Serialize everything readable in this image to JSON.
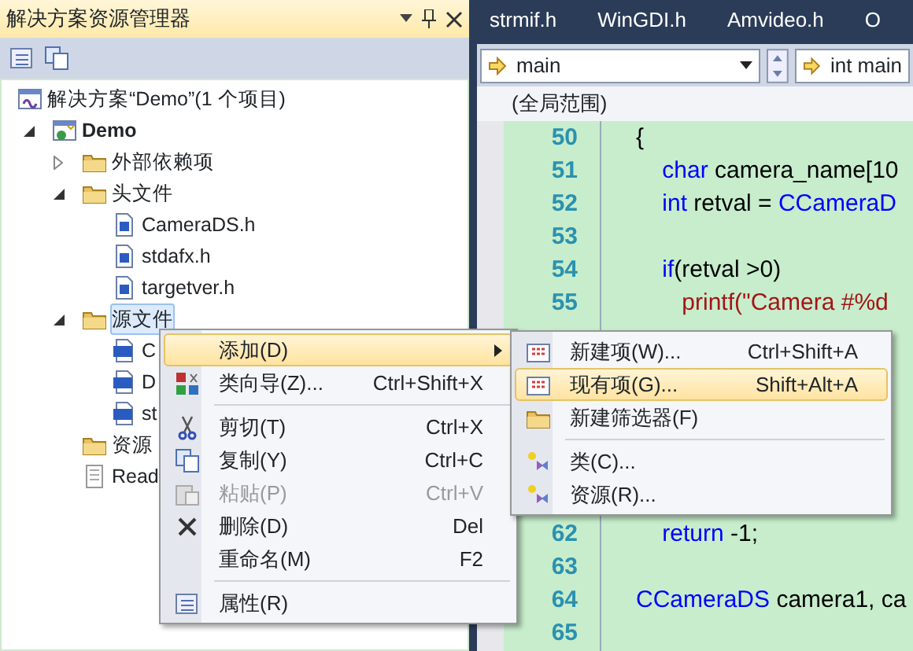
{
  "explorer": {
    "title": "解决方案资源管理器",
    "tree": [
      {
        "label": "解决方案“Demo”(1 个项目)",
        "kind": "solution",
        "selected": false,
        "children": [
          {
            "label": "Demo",
            "kind": "project",
            "expanded": true,
            "selected": false,
            "children": [
              {
                "label": "外部依赖项",
                "kind": "folder",
                "expanded": false,
                "selected": false
              },
              {
                "label": "头文件",
                "kind": "folder",
                "expanded": true,
                "selected": false,
                "children": [
                  {
                    "label": "CameraDS.h",
                    "kind": "header",
                    "selected": false
                  },
                  {
                    "label": "stdafx.h",
                    "kind": "header",
                    "selected": false
                  },
                  {
                    "label": "targetver.h",
                    "kind": "header",
                    "selected": false
                  }
                ]
              },
              {
                "label": "源文件",
                "kind": "folder",
                "expanded": true,
                "selected": true,
                "children": [
                  {
                    "label": "C",
                    "kind": "cpp",
                    "selected": false
                  },
                  {
                    "label": "D",
                    "kind": "cpp",
                    "selected": false
                  },
                  {
                    "label": "st",
                    "kind": "cpp",
                    "selected": false
                  }
                ]
              },
              {
                "label": "资源",
                "kind": "folder",
                "selected": false
              },
              {
                "label": "Read",
                "kind": "text",
                "selected": false
              }
            ]
          }
        ]
      }
    ]
  },
  "editor": {
    "tabs": [
      "strmif.h",
      "WinGDI.h",
      "Amvideo.h",
      "O"
    ],
    "nav": {
      "left": "main",
      "right": "int main"
    },
    "scope": "(全局范围)",
    "lines": [
      {
        "number": "50",
        "parts": [
          {
            "kind": "plain",
            "text": "{"
          }
        ]
      },
      {
        "number": "51",
        "parts": [
          {
            "kind": "keyword",
            "text": "    char"
          },
          {
            "kind": "plain",
            "text": " camera_name[10"
          }
        ]
      },
      {
        "number": "52",
        "parts": [
          {
            "kind": "keyword",
            "text": "    int"
          },
          {
            "kind": "plain",
            "text": " retval = "
          },
          {
            "kind": "type",
            "text": "CCameraD"
          }
        ]
      },
      {
        "number": "53"
      },
      {
        "number": "54",
        "parts": [
          {
            "kind": "keyword",
            "text": "    if"
          },
          {
            "kind": "plain",
            "text": "(retval >0)"
          }
        ]
      },
      {
        "number": "55",
        "parts": [
          {
            "kind": "string",
            "text": "       printf(\"Camera #%d"
          }
        ]
      },
      {
        "number": "62",
        "parts": [
          {
            "kind": "keyword",
            "text": "    return"
          },
          {
            "kind": "plain",
            "text": " -1;"
          }
        ]
      },
      {
        "number": "63"
      },
      {
        "number": "64",
        "parts": [
          {
            "kind": "type",
            "text": "CCameraDS"
          },
          {
            "kind": "plain",
            "text": " camera1, ca"
          }
        ]
      },
      {
        "number": "65"
      }
    ]
  },
  "context_menu": [
    {
      "kind": "item",
      "label": "添加(D)",
      "submenu": true,
      "selected": true,
      "disabled": false
    },
    {
      "kind": "item",
      "label": "类向导(Z)...",
      "shortcut": "Ctrl+Shift+X",
      "selected": false,
      "disabled": false
    },
    {
      "kind": "separator"
    },
    {
      "kind": "item",
      "label": "剪切(T)",
      "shortcut": "Ctrl+X",
      "selected": false,
      "disabled": false
    },
    {
      "kind": "item",
      "label": "复制(Y)",
      "shortcut": "Ctrl+C",
      "selected": false,
      "disabled": false
    },
    {
      "kind": "item",
      "label": "粘贴(P)",
      "shortcut": "Ctrl+V",
      "selected": false,
      "disabled": true
    },
    {
      "kind": "item",
      "label": "删除(D)",
      "shortcut": "Del",
      "selected": false,
      "disabled": false
    },
    {
      "kind": "item",
      "label": "重命名(M)",
      "shortcut": "F2",
      "selected": false,
      "disabled": false
    },
    {
      "kind": "separator"
    },
    {
      "kind": "item",
      "label": "属性(R)",
      "selected": false,
      "disabled": false
    }
  ],
  "submenu": [
    {
      "kind": "item",
      "label": "新建项(W)...",
      "shortcut": "Ctrl+Shift+A",
      "selected": false
    },
    {
      "kind": "item",
      "label": "现有项(G)...",
      "shortcut": "Shift+Alt+A",
      "selected": true
    },
    {
      "kind": "item",
      "label": "新建筛选器(F)",
      "selected": false
    },
    {
      "kind": "separator"
    },
    {
      "kind": "item",
      "label": "类(C)...",
      "selected": false
    },
    {
      "kind": "item",
      "label": "资源(R)...",
      "selected": false
    }
  ]
}
